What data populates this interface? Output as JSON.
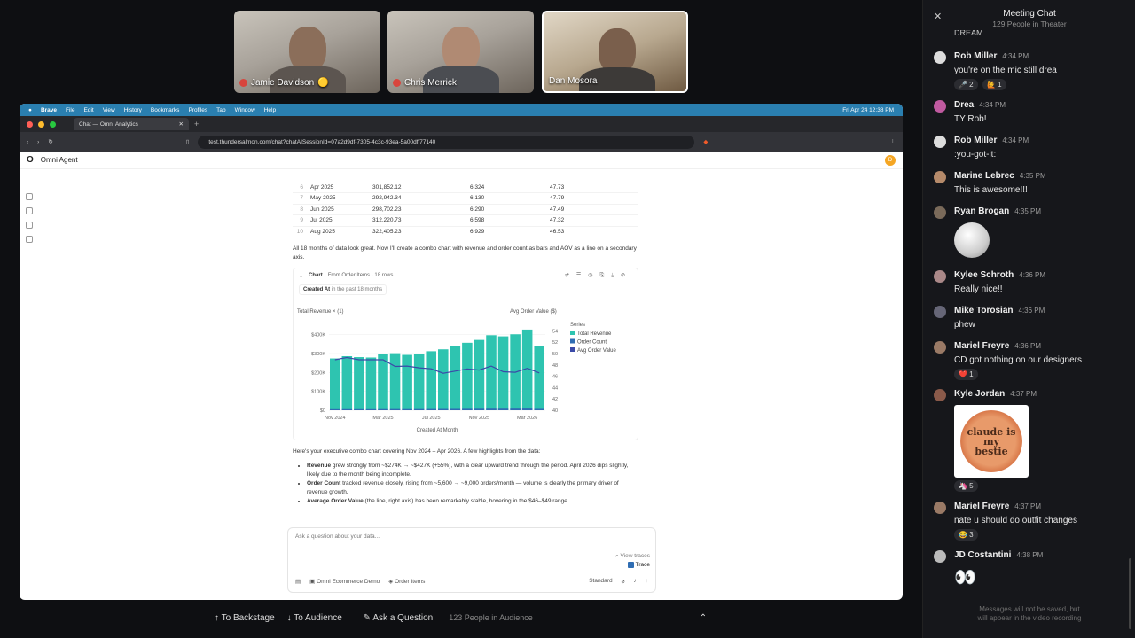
{
  "participants": [
    {
      "name": "Jamie Davidson",
      "muted": true,
      "badge": "🟡"
    },
    {
      "name": "Chris Merrick",
      "muted": true
    },
    {
      "name": "Dan Mosora",
      "muted": false,
      "active": true
    }
  ],
  "mac_menu": [
    "Brave",
    "File",
    "Edit",
    "View",
    "History",
    "Bookmarks",
    "Profiles",
    "Tab",
    "Window",
    "Help"
  ],
  "mac_clock": "Fri Apr 24  12:38 PM",
  "browser": {
    "tab_title": "Chat — Omni Analytics",
    "url": "test.thundersalmon.com/chat?chatAISessionId=07a2d9df-7305-4c3c-93ea-5a00dff77140"
  },
  "app": {
    "title": "Omni Agent",
    "user_initial": "D"
  },
  "table_rows": [
    {
      "n": "6",
      "month": "Apr 2025",
      "revenue": "301,852.12",
      "orders": "6,324",
      "aov": "47.73"
    },
    {
      "n": "7",
      "month": "May 2025",
      "revenue": "292,942.34",
      "orders": "6,130",
      "aov": "47.79"
    },
    {
      "n": "8",
      "month": "Jun 2025",
      "revenue": "298,702.23",
      "orders": "6,290",
      "aov": "47.49"
    },
    {
      "n": "9",
      "month": "Jul 2025",
      "revenue": "312,220.73",
      "orders": "6,598",
      "aov": "47.32"
    },
    {
      "n": "10",
      "month": "Aug 2025",
      "revenue": "322,405.23",
      "orders": "6,929",
      "aov": "46.53"
    }
  ],
  "intro_text": "All 18 months of data look great. Now I'll create a combo chart with revenue and order count as bars and AOV as a line on a secondary axis.",
  "chart_card": {
    "label": "Chart",
    "source": "From Order Items · 18 rows",
    "filter_field": "Created At",
    "filter_value": "in the past 18 months"
  },
  "chart_data": {
    "type": "bar",
    "categories": [
      "Nov 2024",
      "Dec 2024",
      "Jan 2025",
      "Feb 2025",
      "Mar 2025",
      "Apr 2025",
      "May 2025",
      "Jun 2025",
      "Jul 2025",
      "Aug 2025",
      "Sep 2025",
      "Oct 2025",
      "Nov 2025",
      "Dec 2025",
      "Jan 2026",
      "Feb 2026",
      "Mar 2026",
      "Apr 2026"
    ],
    "x_tick_labels": [
      "Nov 2024",
      "Mar 2025",
      "Jul 2025",
      "Nov 2025",
      "Mar 2026"
    ],
    "series": [
      {
        "name": "Total Revenue",
        "type": "bar",
        "axis": "left",
        "values": [
          274000,
          286000,
          281000,
          279000,
          296000,
          301852,
          292942,
          298702,
          312220,
          322405,
          338000,
          357000,
          372000,
          397000,
          391000,
          402000,
          427000,
          340000
        ]
      },
      {
        "name": "Order Count",
        "type": "bar",
        "axis": "left",
        "values": [
          5600,
          5800,
          5750,
          5700,
          6050,
          6324,
          6130,
          6290,
          6598,
          6929,
          7200,
          7550,
          7900,
          8300,
          8350,
          8600,
          9000,
          7300
        ]
      },
      {
        "name": "Avg Order Value",
        "type": "line",
        "axis": "right",
        "values": [
          48.9,
          49.3,
          48.9,
          48.9,
          48.9,
          47.73,
          47.79,
          47.49,
          47.32,
          46.53,
          46.9,
          47.3,
          47.1,
          47.8,
          46.8,
          46.7,
          47.4,
          46.6
        ]
      }
    ],
    "ylabel": "Total Revenue × (1)",
    "y2label": "Avg Order Value ($)",
    "xlabel": "Created At Month",
    "ylim": [
      0,
      450000
    ],
    "y_ticks": [
      "$0",
      "$100K",
      "$200K",
      "$300K",
      "$400K"
    ],
    "y2lim": [
      40,
      55
    ],
    "y2_ticks": [
      "40",
      "42",
      "44",
      "46",
      "48",
      "50",
      "52",
      "54"
    ],
    "legend_title": "Series",
    "legend": [
      "Total Revenue",
      "Order Count",
      "Avg Order Value"
    ],
    "colors": {
      "revenue": "#2ec4b0",
      "orders": "#2f6db3",
      "aov": "#3b4aa8"
    }
  },
  "summary_intro": "Here's your executive combo chart covering Nov 2024 – Apr 2026. A few highlights from the data:",
  "bullets": [
    {
      "bold": "Revenue",
      "text": " grew strongly from ~$274K → ~$427K (+55%), with a clear upward trend through the period. April 2026 dips slightly, likely due to the month being incomplete."
    },
    {
      "bold": "Order Count",
      "text": " tracked revenue closely, rising from ~5,600 → ~9,000 orders/month — volume is clearly the primary driver of revenue growth."
    },
    {
      "bold": "Average Order Value",
      "text": " (the line, right axis) has been remarkably stable, hovering in the $46–$49 range"
    }
  ],
  "ask_box": {
    "placeholder": "Ask a question about your data...",
    "view_traces": "View traces",
    "trace": "Trace",
    "workspace": "Omni Ecommerce Demo",
    "topic": "Order Items",
    "mode": "Standard"
  },
  "bottom_bar": {
    "backstage": "To Backstage",
    "audience": "To Audience",
    "ask": "Ask a Question",
    "count": "123 People in Audience"
  },
  "chat": {
    "title": "Meeting Chat",
    "subtitle": "129 People in Theater",
    "cut_top": "DREAM.",
    "messages": [
      {
        "name": "Rob Miller",
        "time": "4:34 PM",
        "text": "you're on the mic still drea",
        "reactions": [
          "🎤 2",
          "🙋 1"
        ]
      },
      {
        "name": "Drea",
        "time": "4:34 PM",
        "text": "TY Rob!"
      },
      {
        "name": "Rob Miller",
        "time": "4:34 PM",
        "text": ":you-got-it:"
      },
      {
        "name": "Marine Lebrec",
        "time": "4:35 PM",
        "text": "This is awesome!!!"
      },
      {
        "name": "Ryan Brogan",
        "time": "4:35 PM",
        "text": ""
      },
      {
        "name": "Kylee Schroth",
        "time": "4:36 PM",
        "text": "Really nice!!"
      },
      {
        "name": "Mike Torosian",
        "time": "4:36 PM",
        "text": "phew"
      },
      {
        "name": "Mariel Freyre",
        "time": "4:36 PM",
        "text": "CD got nothing on our designers",
        "reactions": [
          "❤️ 1"
        ]
      },
      {
        "name": "Kyle Jordan",
        "time": "4:37 PM",
        "text": "",
        "sticker": "claude is my bestie",
        "reactions": [
          "🦄 5"
        ]
      },
      {
        "name": "Mariel Freyre",
        "time": "4:37 PM",
        "text": "nate u should do outfit changes",
        "reactions": [
          "😂 3"
        ]
      },
      {
        "name": "JD Costantini",
        "time": "4:38 PM",
        "text": "👀"
      }
    ],
    "footer": "Messages will not be saved, but\nwill appear in the video recording"
  }
}
